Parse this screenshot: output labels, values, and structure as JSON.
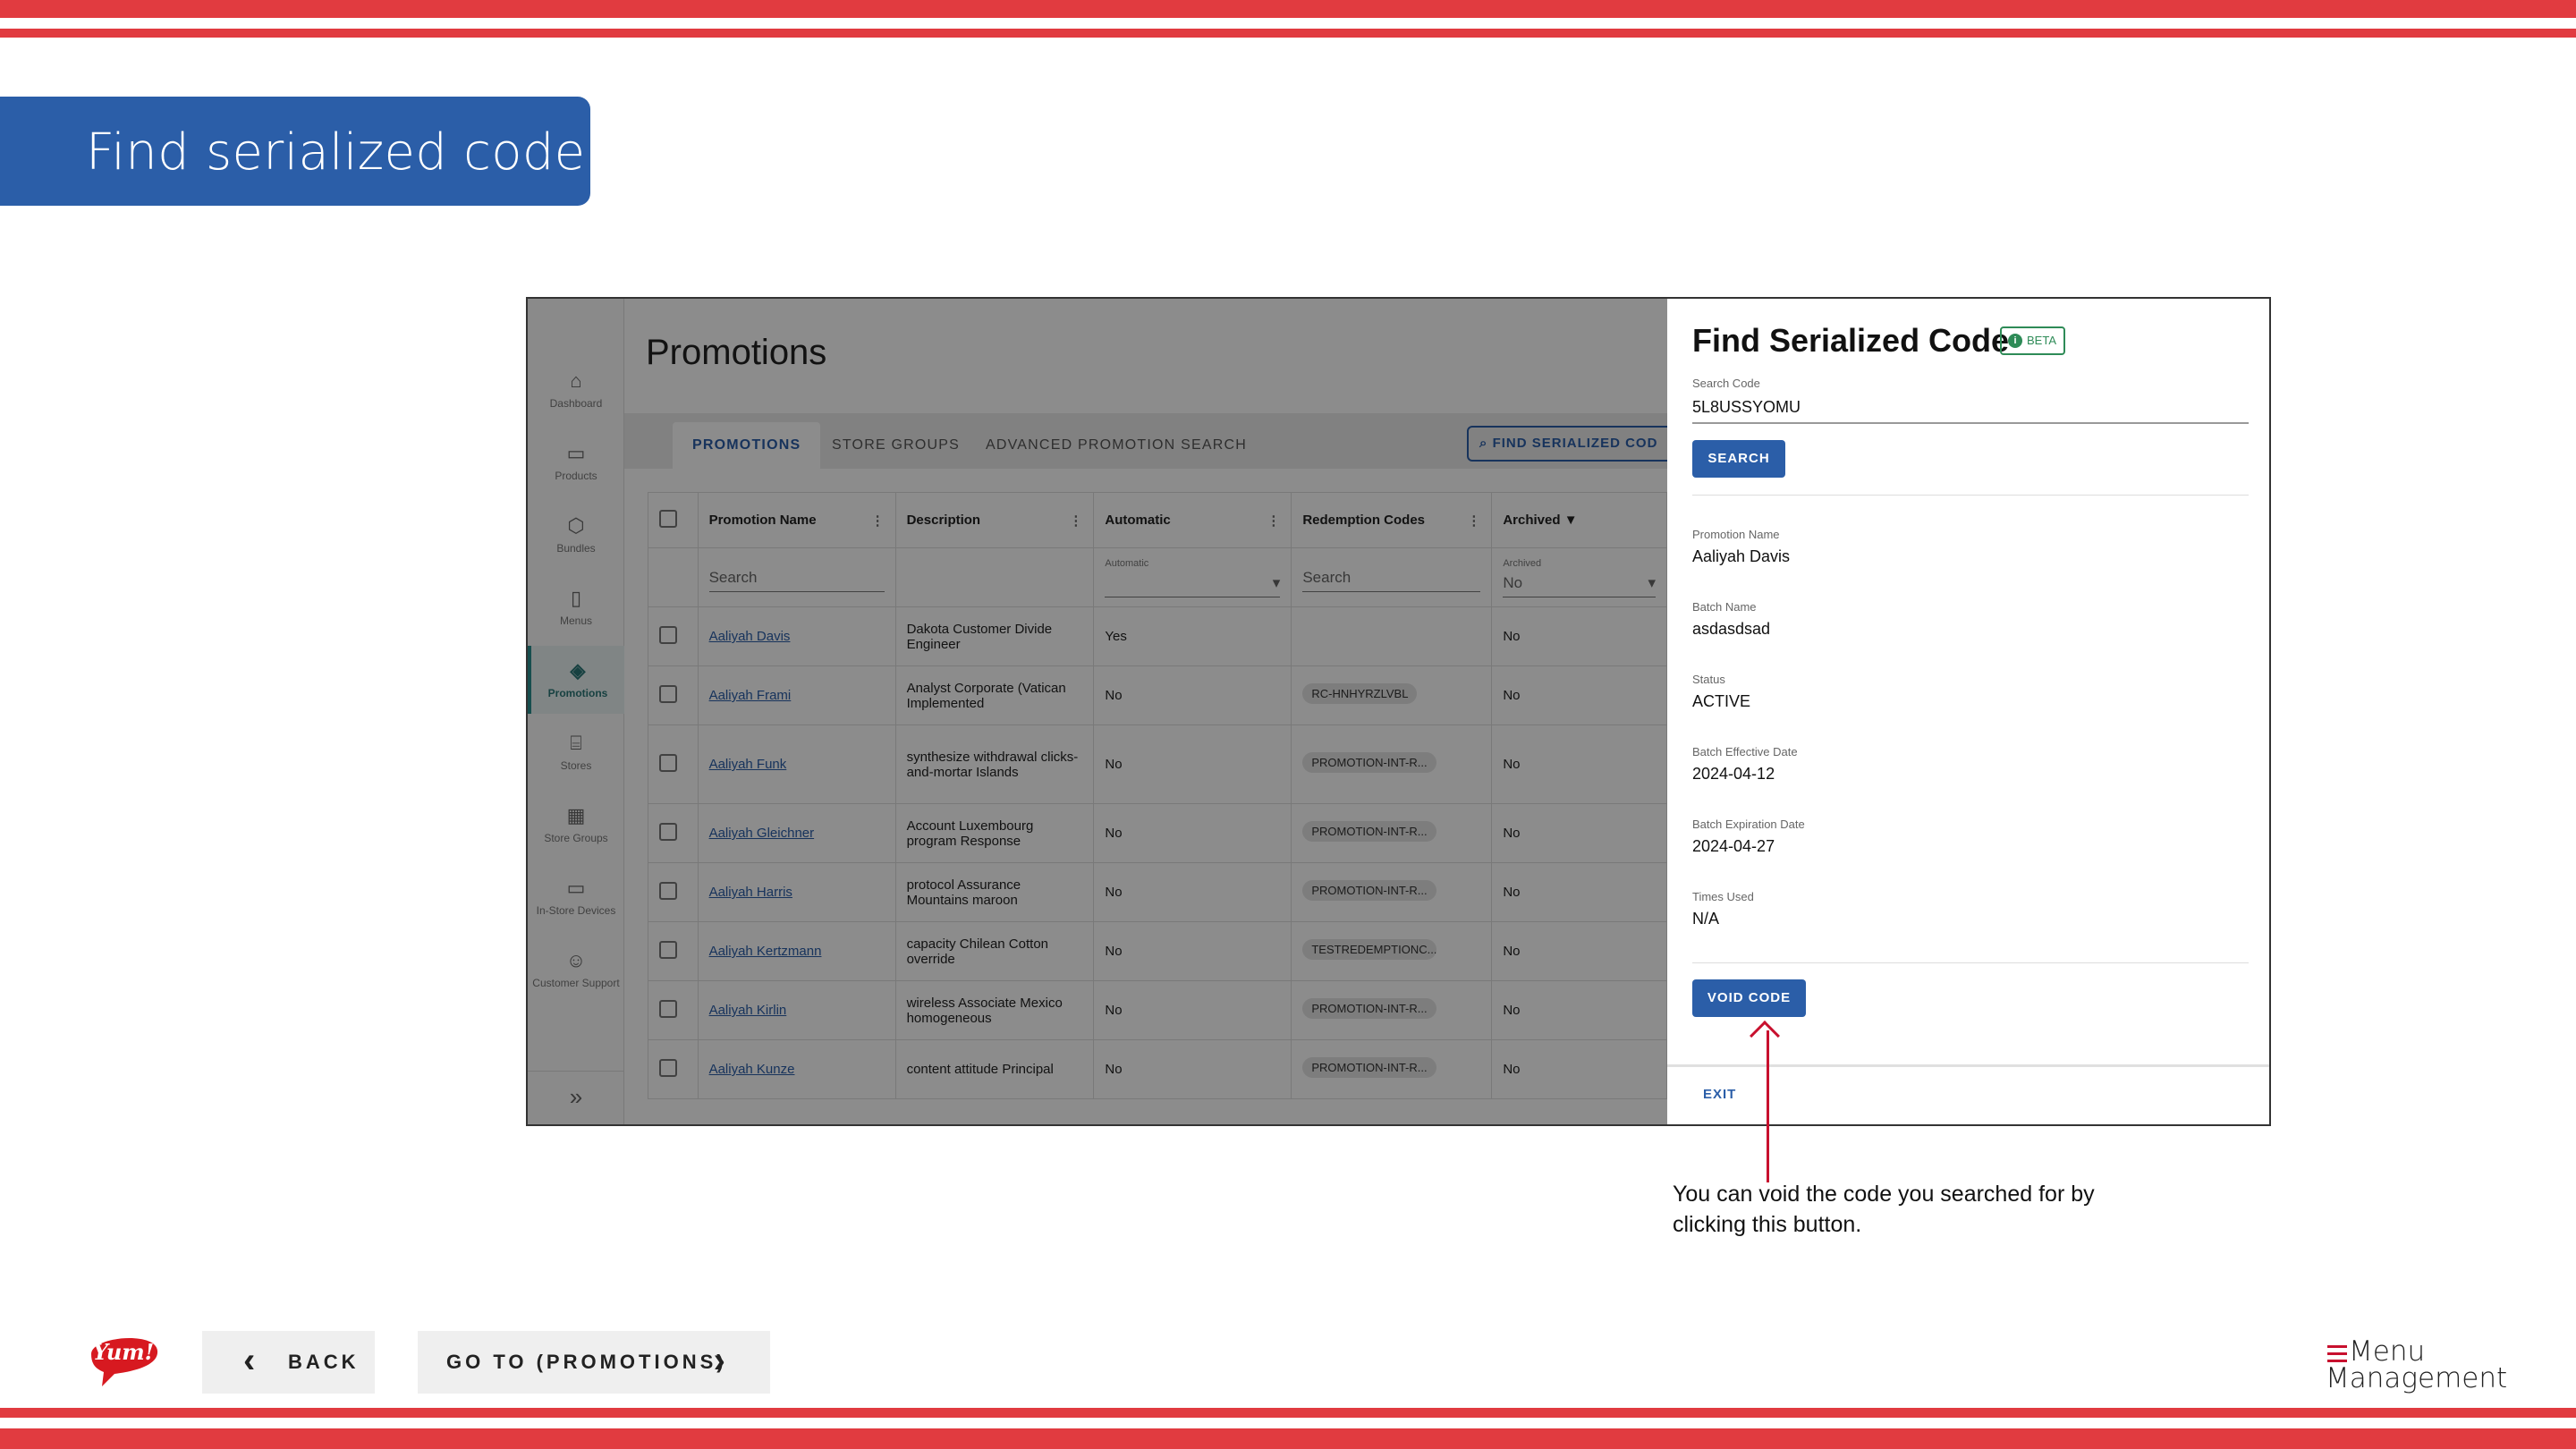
{
  "page_title": "Find serialized code",
  "sidebar": {
    "items": [
      {
        "label": "Dashboard",
        "icon": "home-icon"
      },
      {
        "label": "Products",
        "icon": "box-icon"
      },
      {
        "label": "Bundles",
        "icon": "cube-icon"
      },
      {
        "label": "Menus",
        "icon": "document-icon"
      },
      {
        "label": "Promotions",
        "icon": "tag-icon",
        "active": true
      },
      {
        "label": "Stores",
        "icon": "store-icon"
      },
      {
        "label": "Store Groups",
        "icon": "grid-icon"
      },
      {
        "label": "In-Store Devices",
        "icon": "monitor-icon"
      },
      {
        "label": "Customer Support",
        "icon": "support-icon"
      }
    ],
    "expand": "»"
  },
  "main": {
    "heading": "Promotions",
    "tabs": [
      "PROMOTIONS",
      "STORE GROUPS",
      "ADVANCED PROMOTION SEARCH"
    ],
    "find_button": "FIND SERIALIZED COD",
    "columns": [
      "Promotion Name",
      "Description",
      "Automatic",
      "Redemption Codes",
      "Archived"
    ],
    "filters": {
      "name_placeholder": "Search",
      "automatic_label": "Automatic",
      "codes_placeholder": "Search",
      "archived_label": "Archived",
      "archived_value": "No"
    },
    "rows": [
      {
        "name": "Aaliyah Davis",
        "desc": "Dakota Customer Divide Engineer",
        "auto": "Yes",
        "code": "",
        "archived": "No"
      },
      {
        "name": "Aaliyah Frami",
        "desc": "Analyst Corporate (Vatican Implemented",
        "auto": "No",
        "code": "RC-HNHYRZLVBL",
        "archived": "No"
      },
      {
        "name": "Aaliyah Funk",
        "desc": "synthesize withdrawal clicks-and-mortar Islands",
        "auto": "No",
        "code": "PROMOTION-INT-R...",
        "archived": "No"
      },
      {
        "name": "Aaliyah Gleichner",
        "desc": "Account Luxembourg program Response",
        "auto": "No",
        "code": "PROMOTION-INT-R...",
        "archived": "No"
      },
      {
        "name": "Aaliyah Harris",
        "desc": "protocol Assurance Mountains maroon",
        "auto": "No",
        "code": "PROMOTION-INT-R...",
        "archived": "No"
      },
      {
        "name": "Aaliyah Kertzmann",
        "desc": "capacity Chilean Cotton override",
        "auto": "No",
        "code": "TESTREDEMPTIONC...",
        "archived": "No"
      },
      {
        "name": "Aaliyah Kirlin",
        "desc": "wireless Associate Mexico homogeneous",
        "auto": "No",
        "code": "PROMOTION-INT-R...",
        "archived": "No"
      },
      {
        "name": "Aaliyah Kunze",
        "desc": "content attitude Principal",
        "auto": "No",
        "code": "PROMOTION-INT-R...",
        "archived": "No"
      }
    ]
  },
  "drawer": {
    "title": "Find Serialized Code",
    "badge": "BETA",
    "search_label": "Search Code",
    "search_value": "5L8USSYOMU",
    "search_button": "SEARCH",
    "fields": [
      {
        "label": "Promotion Name",
        "value": "Aaliyah Davis"
      },
      {
        "label": "Batch Name",
        "value": "asdasdsad"
      },
      {
        "label": "Status",
        "value": "ACTIVE"
      },
      {
        "label": "Batch Effective Date",
        "value": "2024-04-12"
      },
      {
        "label": "Batch Expiration Date",
        "value": "2024-04-27"
      },
      {
        "label": "Times Used",
        "value": "N/A"
      }
    ],
    "void_button": "VOID CODE",
    "exit_button": "EXIT"
  },
  "callout": "You can void the code you searched for by clicking this button.",
  "bottom_nav": {
    "back": "BACK",
    "goto": "GO TO (PROMOTIONS)",
    "logo_text": "Yum!",
    "brand_line1": "Menu",
    "brand_line2": "Management"
  },
  "colors": {
    "accent": "#2b5ea8",
    "stripe": "#e13b40",
    "callout_arrow": "#c8102e"
  }
}
